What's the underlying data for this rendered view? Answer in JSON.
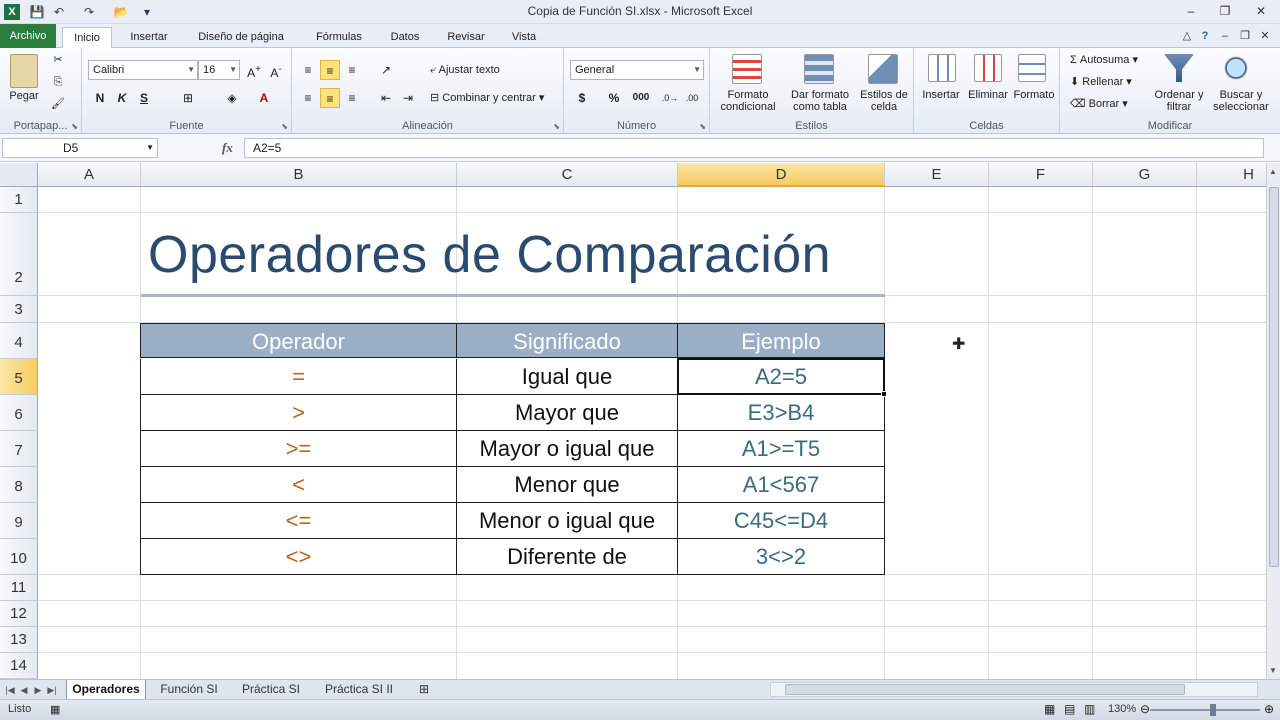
{
  "window": {
    "app_icon": "X",
    "title": "Copia de Función SI.xlsx - Microsoft Excel",
    "controls": [
      "–",
      "❐",
      "✕"
    ]
  },
  "ribbon_tabs": {
    "file": "Archivo",
    "items": [
      "Inicio",
      "Insertar",
      "Diseño de página",
      "Fórmulas",
      "Datos",
      "Revisar",
      "Vista"
    ],
    "active": "Inicio"
  },
  "ribbon": {
    "portapapeles": {
      "label": "Portapap...",
      "paste": "Pegar"
    },
    "fuente": {
      "label": "Fuente",
      "font_name": "Calibri",
      "font_size": "16",
      "bold": "N",
      "italic": "K",
      "underline": "S"
    },
    "alineacion": {
      "label": "Alineación",
      "wrap": "Ajustar texto",
      "merge": "Combinar y centrar"
    },
    "numero": {
      "label": "Número",
      "format": "General",
      "currency": "$",
      "percent": "%",
      "thousands": "000"
    },
    "estilos": {
      "label": "Estilos",
      "conditional": "Formato condicional",
      "as_table": "Dar formato como tabla",
      "cell_styles": "Estilos de celda"
    },
    "celdas": {
      "label": "Celdas",
      "insert": "Insertar",
      "delete": "Eliminar",
      "format": "Formato"
    },
    "modificar": {
      "label": "Modificar",
      "autosum": "Autosuma",
      "fill": "Rellenar",
      "clear": "Borrar",
      "sort": "Ordenar y filtrar",
      "find": "Buscar y seleccionar"
    }
  },
  "formula_bar": {
    "name_box": "D5",
    "fx": "fx",
    "formula": "A2=5"
  },
  "columns": [
    "A",
    "B",
    "C",
    "D",
    "E",
    "F",
    "G",
    "H"
  ],
  "rows": [
    "1",
    "2",
    "3",
    "4",
    "5",
    "6",
    "7",
    "8",
    "9",
    "10",
    "11",
    "12",
    "13",
    "14"
  ],
  "sheet": {
    "title": "Operadores de Comparación",
    "headers": [
      "Operador",
      "Significado",
      "Ejemplo"
    ],
    "table": [
      {
        "op": "=",
        "sig": "Igual que",
        "ej": "A2=5"
      },
      {
        "op": ">",
        "sig": "Mayor que",
        "ej": "E3>B4"
      },
      {
        "op": ">=",
        "sig": "Mayor o igual que",
        "ej": "A1>=T5"
      },
      {
        "op": "<",
        "sig": "Menor que",
        "ej": "A1<567"
      },
      {
        "op": "<=",
        "sig": "Menor o igual que",
        "ej": "C45<=D4"
      },
      {
        "op": "<>",
        "sig": "Diferente de",
        "ej": "3<>2"
      }
    ]
  },
  "sheet_tabs": [
    "Operadores",
    "Función SI",
    "Práctica SI",
    "Práctica SI II"
  ],
  "status": {
    "ready": "Listo",
    "zoom": "130%"
  }
}
